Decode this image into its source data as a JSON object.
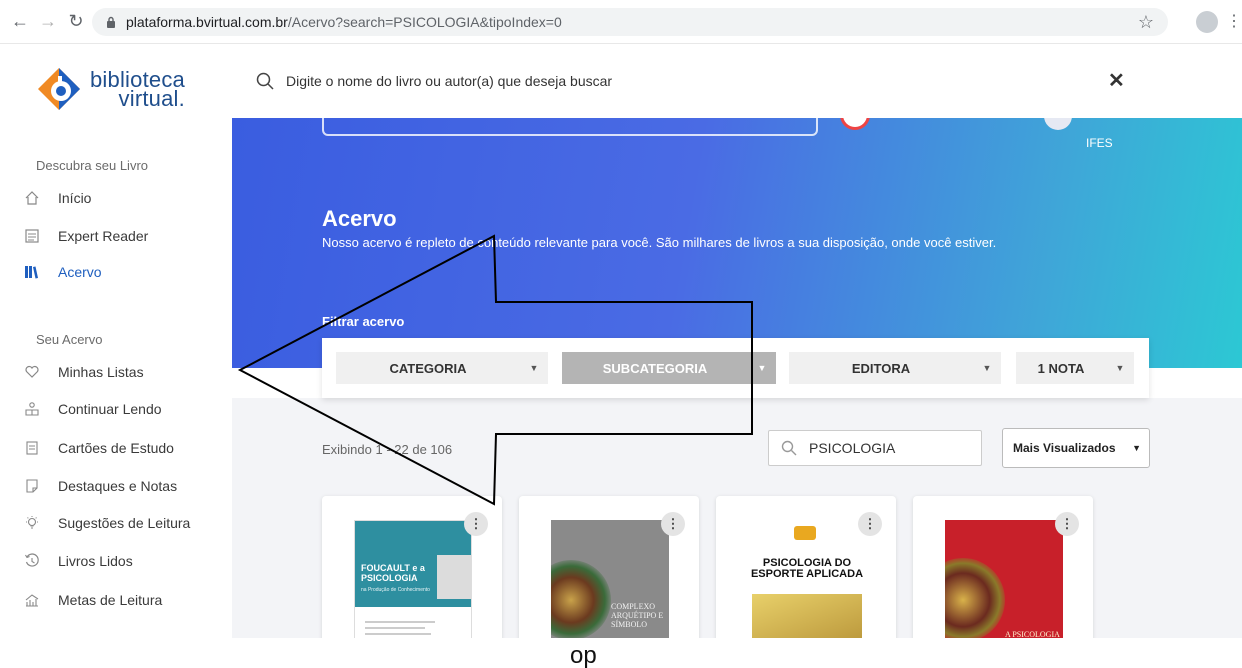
{
  "browser": {
    "url_host": "plataforma.bvirtual.com.br",
    "url_path": "/Acervo?search=PSICOLOGIA&tipoIndex=0"
  },
  "logo": {
    "line1": "biblioteca",
    "line2": "virtual."
  },
  "sidebar": {
    "section1_title": "Descubra seu Livro",
    "section1_items": [
      {
        "label": "Início",
        "icon": "home-icon"
      },
      {
        "label": "Expert Reader",
        "icon": "reader-icon"
      },
      {
        "label": "Acervo",
        "icon": "library-icon",
        "active": true
      }
    ],
    "section2_title": "Seu Acervo",
    "section2_items": [
      {
        "label": "Minhas Listas",
        "icon": "heart-icon"
      },
      {
        "label": "Continuar Lendo",
        "icon": "reading-person-icon"
      },
      {
        "label": "Cartões de Estudo",
        "icon": "card-icon"
      },
      {
        "label": "Destaques e Notas",
        "icon": "note-icon"
      },
      {
        "label": "Sugestões de Leitura",
        "icon": "lightbulb-icon"
      },
      {
        "label": "Livros Lidos",
        "icon": "history-icon"
      },
      {
        "label": "Metas de Leitura",
        "icon": "goals-icon"
      }
    ]
  },
  "top_search": {
    "placeholder": "Digite o nome do livro ou autor(a) que deseja buscar",
    "close": "✕"
  },
  "hero": {
    "user_label": "IFES",
    "title": "Acervo",
    "subtitle": "Nosso acervo é repleto de conteúdo relevante para você. São milhares de livros a sua disposição, onde você estiver.",
    "filter_label": "Filtrar acervo"
  },
  "filters": [
    {
      "label": "CATEGORIA"
    },
    {
      "label": "SUBCATEGORIA",
      "disabled": true
    },
    {
      "label": "EDITORA"
    },
    {
      "label": "1 NOTA"
    }
  ],
  "results": {
    "count_text": "Exibindo 1 - 22 de 106",
    "search_value": "PSICOLOGIA",
    "sort_value": "Mais Visualizados"
  },
  "books": [
    {
      "cover_title": "FOUCAULT e a PSICOLOGIA",
      "cover_subtitle": "na Produção de Conhecimento",
      "color": "#2e8fa0"
    },
    {
      "cover_title": "COMPLEXO ARQUÉTIPO E SÍMBOLO",
      "color": "#8a8a8a"
    },
    {
      "cover_title": "PSICOLOGIA DO ESPORTE APLICADA",
      "color": "#f0d44a"
    },
    {
      "cover_title": "A PSICOLOGIA DE C.G. JUNG",
      "color": "#c8202a"
    }
  ],
  "footer_text": "op",
  "colors": {
    "accent": "#1f5fbf",
    "hero_start": "#3a5de0",
    "hero_end": "#2cc8d4"
  }
}
